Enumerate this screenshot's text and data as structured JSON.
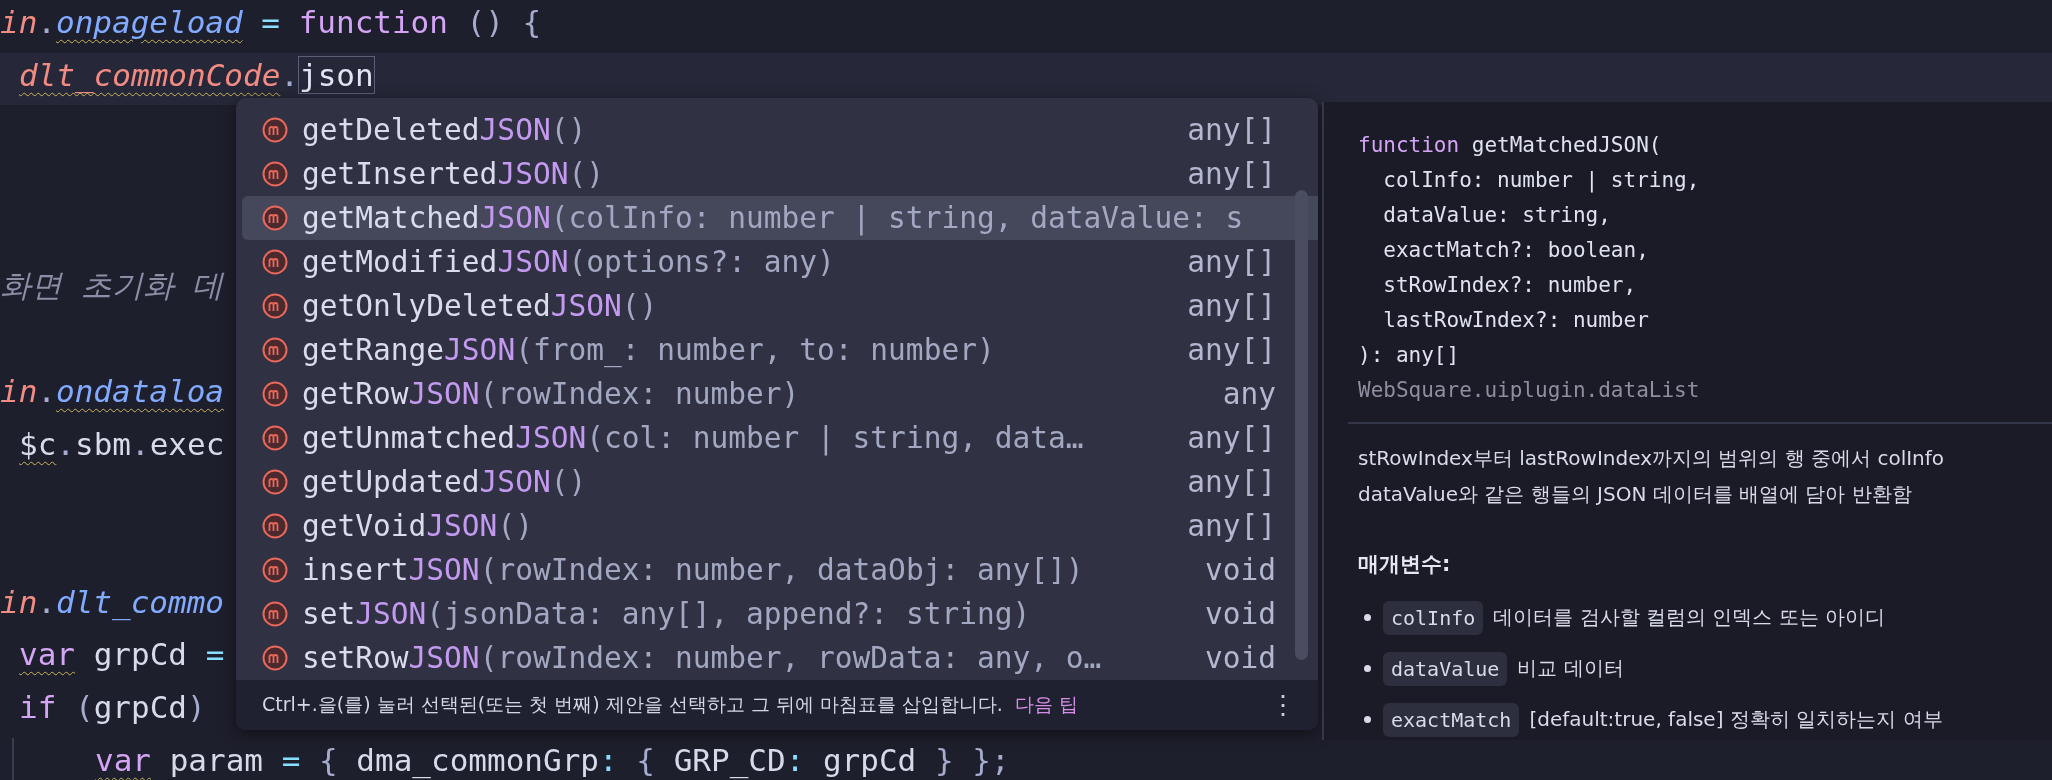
{
  "editor": {
    "lines": [
      {
        "kind": "top",
        "current": false,
        "tokens": [
          {
            "kind": "variable",
            "text": "in"
          },
          {
            "kind": "punct",
            "text": "."
          },
          {
            "kind": "property",
            "text": "onpageload",
            "flagged": true
          },
          {
            "kind": "operator",
            "text": " = "
          },
          {
            "kind": "keyword",
            "text": "function"
          },
          {
            "kind": "punct",
            "text": " () {"
          }
        ]
      },
      {
        "kind": "inner",
        "current": true,
        "tokens": [
          {
            "kind": "variable",
            "text": "dlt_commonCode",
            "flagged": true
          },
          {
            "kind": "punct",
            "text": "."
          },
          {
            "kind": "typed",
            "text": "json"
          }
        ]
      },
      {
        "kind": "blank",
        "current": false
      },
      {
        "kind": "blank",
        "current": false
      },
      {
        "kind": "blank",
        "current": false
      },
      {
        "kind": "top",
        "current": false,
        "tokens": [
          {
            "kind": "comment",
            "text": "화면 초기화 데"
          }
        ]
      },
      {
        "kind": "blank",
        "current": false
      },
      {
        "kind": "top",
        "current": false,
        "tokens": [
          {
            "kind": "variable",
            "text": "in"
          },
          {
            "kind": "punct",
            "text": "."
          },
          {
            "kind": "property",
            "text": "ondataloa",
            "flagged": true
          }
        ]
      },
      {
        "kind": "inner",
        "current": false,
        "tokens": [
          {
            "kind": "plain",
            "text": "$c",
            "flagged": true
          },
          {
            "kind": "punct",
            "text": "."
          },
          {
            "kind": "plain",
            "text": "sbm"
          },
          {
            "kind": "punct",
            "text": "."
          },
          {
            "kind": "plain",
            "text": "exec"
          }
        ]
      },
      {
        "kind": "blank",
        "current": false
      },
      {
        "kind": "blank",
        "current": false
      },
      {
        "kind": "top",
        "current": false,
        "tokens": [
          {
            "kind": "variable",
            "text": "in"
          },
          {
            "kind": "punct",
            "text": "."
          },
          {
            "kind": "property",
            "text": "dlt_commo"
          }
        ]
      },
      {
        "kind": "inner",
        "current": false,
        "tokens": [
          {
            "kind": "keyword",
            "text": "var",
            "flagged": true
          },
          {
            "kind": "plain",
            "text": " grpCd "
          },
          {
            "kind": "operator",
            "text": "="
          }
        ]
      },
      {
        "kind": "inner",
        "current": false,
        "tokens": [
          {
            "kind": "keyword",
            "text": "if"
          },
          {
            "kind": "punct",
            "text": " ("
          },
          {
            "kind": "plain",
            "text": "grpCd"
          },
          {
            "kind": "punct",
            "text": ")"
          }
        ]
      },
      {
        "kind": "nested",
        "current": false,
        "tokens": [
          {
            "kind": "keyword",
            "text": "var",
            "flagged": true
          },
          {
            "kind": "plain",
            "text": " param "
          },
          {
            "kind": "operator",
            "text": "="
          },
          {
            "kind": "punct",
            "text": " { "
          },
          {
            "kind": "plain",
            "text": "dma_commonGrp"
          },
          {
            "kind": "operator",
            "text": ":"
          },
          {
            "kind": "punct",
            "text": " { "
          },
          {
            "kind": "plain",
            "text": "GRP_CD"
          },
          {
            "kind": "operator",
            "text": ":"
          },
          {
            "kind": "plain",
            "text": " grpCd"
          },
          {
            "kind": "punct",
            "text": " } };"
          }
        ]
      }
    ]
  },
  "completion": {
    "items": [
      {
        "name": "getDeleted",
        "match": "JSON",
        "params": "()",
        "type": "any[]",
        "selected": false
      },
      {
        "name": "getInserted",
        "match": "JSON",
        "params": "()",
        "type": "any[]",
        "selected": false
      },
      {
        "name": "getMatched",
        "match": "JSON",
        "params": "(colInfo: number | string, dataValue: s",
        "selected": true
      },
      {
        "name": "getModified",
        "match": "JSON",
        "params": "(options?: any)",
        "type": "any[]",
        "selected": false
      },
      {
        "name": "getOnlyDeleted",
        "match": "JSON",
        "params": "()",
        "type": "any[]",
        "selected": false
      },
      {
        "name": "getRange",
        "match": "JSON",
        "params": "(from_: number, to: number)",
        "type": "any[]",
        "selected": false
      },
      {
        "name": "getRow",
        "match": "JSON",
        "params": "(rowIndex: number)",
        "type": "any",
        "selected": false
      },
      {
        "name": "getUnmatched",
        "match": "JSON",
        "params": "(col: number | string, data…",
        "type": "any[]",
        "selected": false
      },
      {
        "name": "getUpdated",
        "match": "JSON",
        "params": "()",
        "type": "any[]",
        "selected": false
      },
      {
        "name": "getVoid",
        "match": "JSON",
        "params": "()",
        "type": "any[]",
        "selected": false
      },
      {
        "name": "insert",
        "match": "JSON",
        "params": "(rowIndex: number, dataObj: any[])",
        "type": "void",
        "selected": false
      },
      {
        "name": "set",
        "match": "JSON",
        "params": "(jsonData: any[], append?: string)",
        "type": "void",
        "selected": false
      },
      {
        "name": "setRow",
        "match": "JSON",
        "params": "(rowIndex: number, rowData: any, o…",
        "type": "void",
        "selected": false
      }
    ],
    "tip": "Ctrl+.을(를) 눌러 선택된(또는 첫 번째) 제안을 선택하고 그 뒤에 마침표를 삽입합니다.",
    "tip_link": "다음 팁",
    "menu": "⋮"
  },
  "documentation": {
    "keyword": "function",
    "signature_start": "getMatchedJSON(",
    "signature": [
      "  colInfo: number | string,",
      "  dataValue: string,",
      "  exactMatch?: boolean,",
      "  stRowIndex?: number,",
      "  lastRowIndex?: number",
      "): any[]"
    ],
    "source": "WebSquare.uiplugin.dataList",
    "description": [
      "stRowIndex부터 lastRowIndex까지의 범위의 행 중에서 colInfo",
      "dataValue와 같은 행들의 JSON 데이터를 배열에 담아 반환함"
    ],
    "params_heading": "매개변수:",
    "params": [
      {
        "name": "colInfo",
        "text": "데이터를 검사할 컬럼의 인덱스 또는 아이디"
      },
      {
        "name": "dataValue",
        "text": "비교 데이터"
      },
      {
        "name": "exactMatch",
        "text": "[default:true, false] 정확히 일치하는지 여부"
      }
    ]
  }
}
